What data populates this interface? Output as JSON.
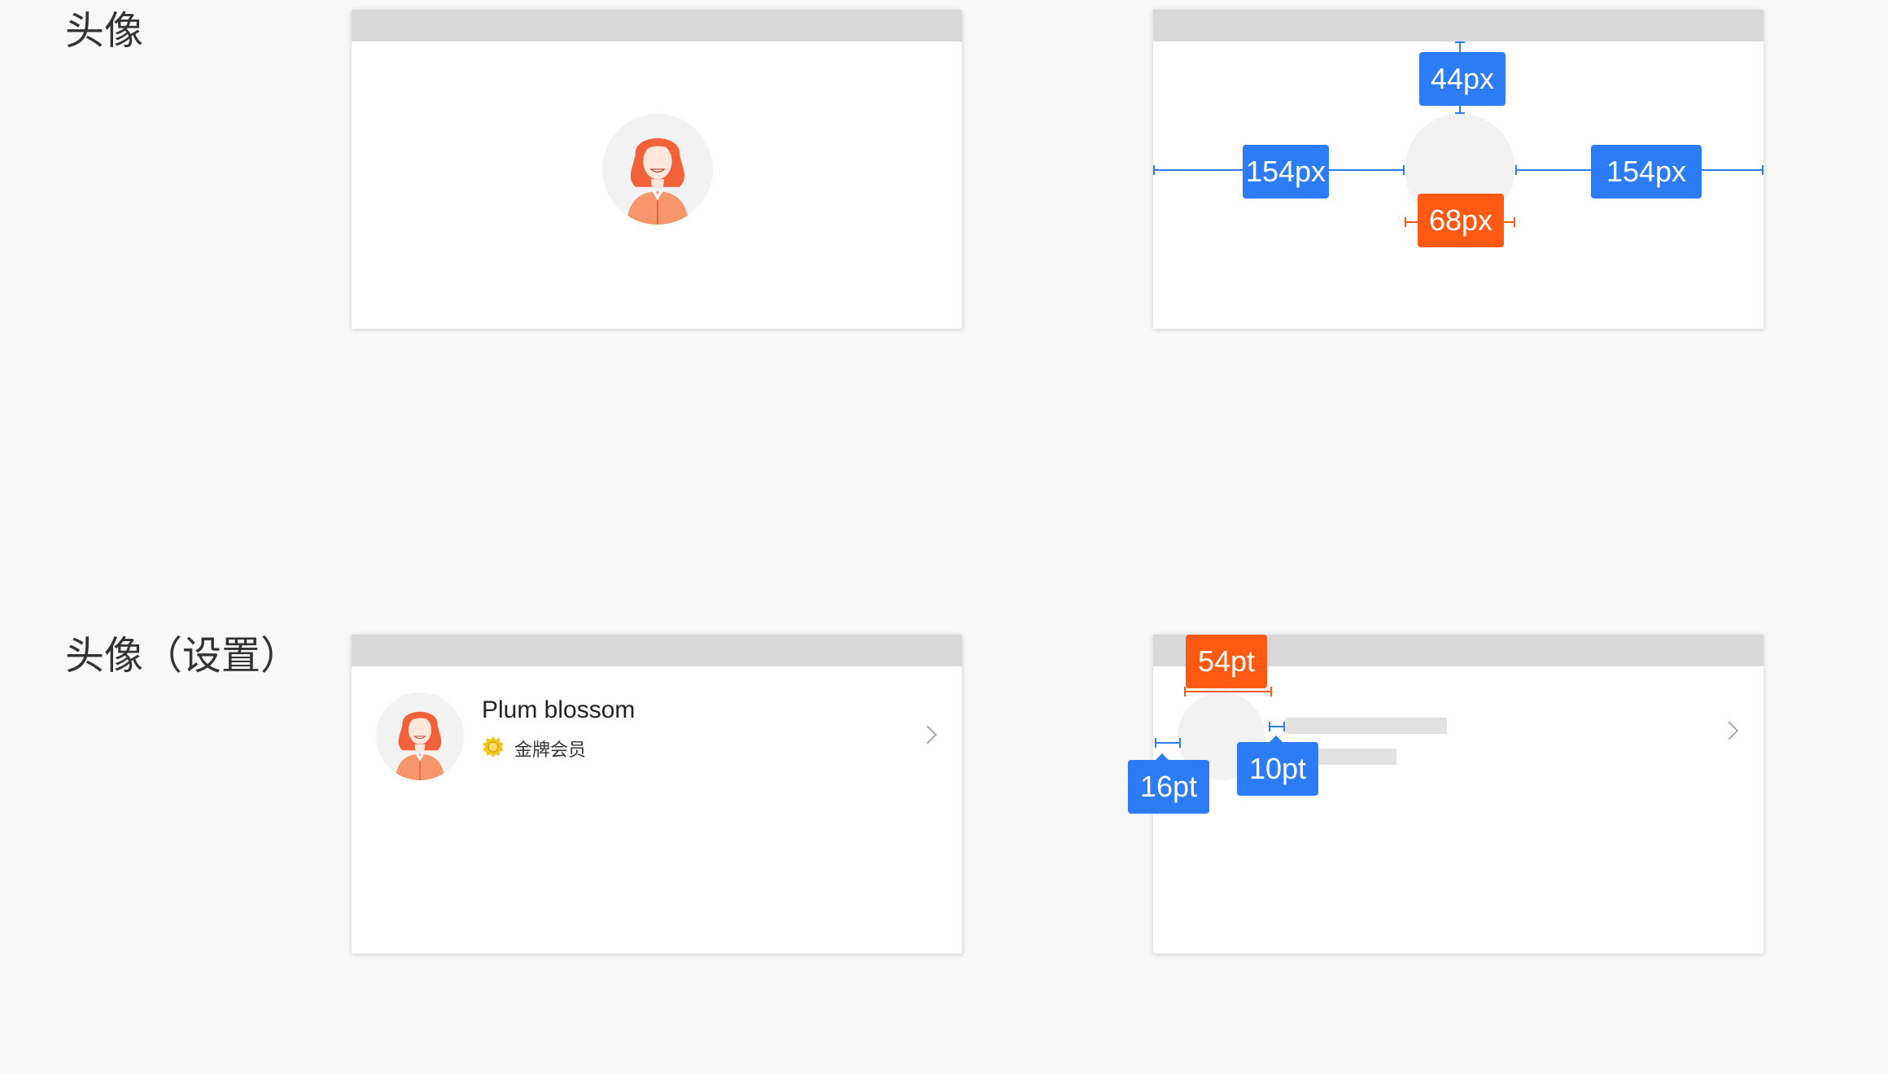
{
  "sections": {
    "avatar": {
      "title": "头像"
    },
    "avatar_settings": {
      "title": "头像（设置）"
    }
  },
  "spec_avatar": {
    "top_margin": "44px",
    "left_margin": "154px",
    "right_margin": "154px",
    "diameter": "68px"
  },
  "profile": {
    "name": "Plum blossom",
    "member_level": "金牌会员"
  },
  "spec_settings": {
    "avatar_size": "54pt",
    "left_margin": "16pt",
    "gap": "10pt"
  },
  "colors": {
    "measure_blue": "#2b7cf6",
    "measure_orange": "#ff5a14",
    "avatar_accent": "#f2623a",
    "header_gray": "#d8d8d8"
  },
  "icons": [
    "female-avatar-icon",
    "gold-medal-icon",
    "chevron-right-icon"
  ]
}
